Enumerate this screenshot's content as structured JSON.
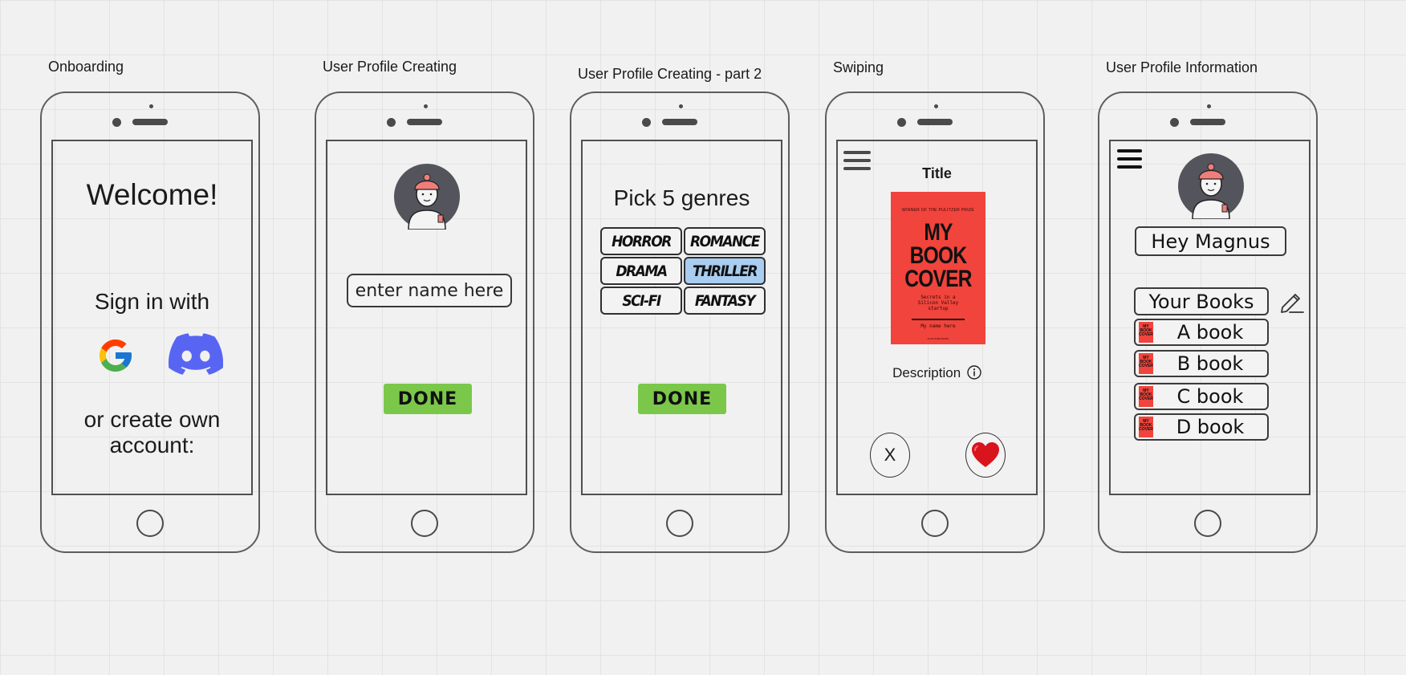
{
  "frames": {
    "onboarding": {
      "label": "Onboarding",
      "welcome": "Welcome!",
      "sign_in": "Sign in with",
      "create_account": "or create own account:"
    },
    "profile_creating": {
      "label": "User Profile Creating",
      "name_placeholder": "enter name here",
      "done": "DONE"
    },
    "profile_creating_2": {
      "label": "User Profile Creating - part 2",
      "heading": "Pick 5 genres",
      "genres": [
        {
          "name": "HORROR",
          "selected": false
        },
        {
          "name": "ROMANCE",
          "selected": false
        },
        {
          "name": "DRAMA",
          "selected": false
        },
        {
          "name": "THRILLER",
          "selected": true
        },
        {
          "name": "SCI-FI",
          "selected": false
        },
        {
          "name": "FANTASY",
          "selected": false
        }
      ],
      "done": "DONE"
    },
    "swiping": {
      "label": "Swiping",
      "title": "Title",
      "cover": {
        "kicker": "WINNER OF THE PULITZER PRIZE",
        "line1": "MY",
        "line2": "BOOK",
        "line3": "COVER",
        "subtitle": "Secrets in a Silicon Valley startup",
        "author": "My name here",
        "publisher": "ALSO PUBLISHING"
      },
      "description": "Description",
      "reject": "X"
    },
    "profile_info": {
      "label": "User Profile Information",
      "greeting": "Hey Magnus",
      "your_books": "Your Books",
      "books": [
        "A book",
        "B book",
        "C book",
        "D book"
      ],
      "thumb_text": "MY BOOK COVER"
    }
  },
  "colors": {
    "done_green": "#7bc74a",
    "selected_genre": "#a9cdf0",
    "cover_red": "#f1443c",
    "discord_purple": "#5865f2",
    "heart_red": "#d8141d",
    "avatar_bg": "#54545c",
    "beanie": "#ef7e7a"
  },
  "icons": [
    "google-icon",
    "discord-icon",
    "avatar",
    "hamburger-menu-icon",
    "info-icon",
    "heart-icon",
    "pencil-edit-icon"
  ]
}
